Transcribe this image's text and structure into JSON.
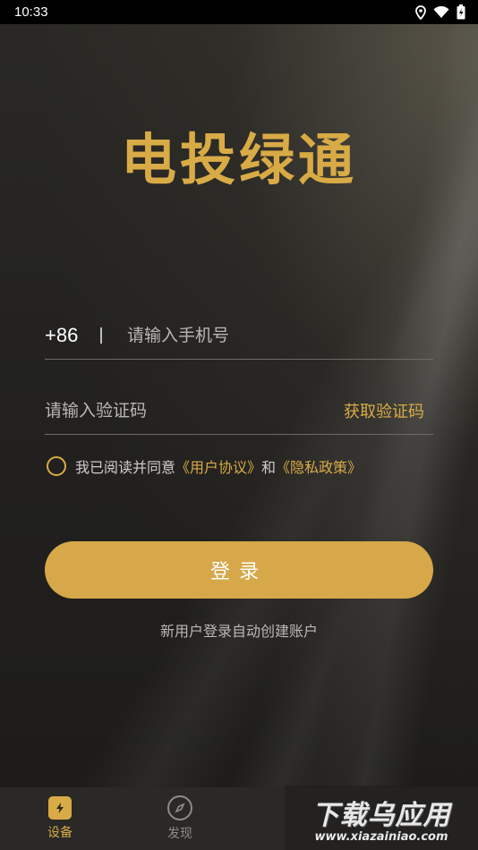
{
  "status_bar": {
    "time": "10:33"
  },
  "app": {
    "title": "电投绿通"
  },
  "login_form": {
    "country_code": "+86",
    "phone_placeholder": "请输入手机号",
    "code_placeholder": "请输入验证码",
    "get_code_label": "获取验证码",
    "agree_prefix": "我已阅读并同意",
    "user_agreement": "《用户协议》",
    "agree_and": "和",
    "privacy_policy": "《隐私政策》",
    "login_label": "登录",
    "auto_create_note": "新用户登录自动创建账户"
  },
  "tab_bar": {
    "tabs": [
      {
        "label": "设备",
        "icon": "device-icon",
        "active": true
      },
      {
        "label": "发现",
        "icon": "compass-icon",
        "active": false
      }
    ]
  },
  "watermark": {
    "main": "下载乌应用",
    "sub": "www.xiazainiao.com"
  },
  "colors": {
    "accent": "#d9ab46",
    "button": "#d6a84a",
    "background": "#1b1a17"
  }
}
